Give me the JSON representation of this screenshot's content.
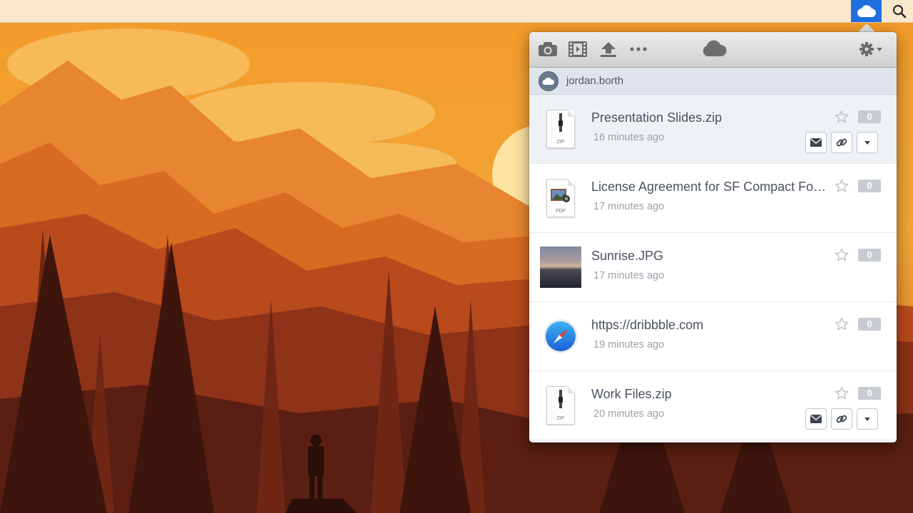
{
  "menubar": {
    "cloud_icon": "cloud-icon",
    "search_icon": "search-icon",
    "accent_color": "#1f6fe0"
  },
  "toolbar": {
    "icons": [
      "camera-icon",
      "film-icon",
      "upload-icon",
      "more-icon",
      "cloud-icon",
      "gear-icon"
    ]
  },
  "account": {
    "username": "jordan.borth"
  },
  "files": [
    {
      "name": "Presentation Slides.zip",
      "time": "16 minutes ago",
      "type": "zip",
      "ext_label": "ZIP",
      "count": "0",
      "selected": true
    },
    {
      "name": "License Agreement for SF Compact Fonts.pdf",
      "time": "17 minutes ago",
      "type": "pdf",
      "ext_label": "PDF",
      "count": "0",
      "selected": false
    },
    {
      "name": "Sunrise.JPG",
      "time": "17 minutes ago",
      "type": "image",
      "count": "0",
      "selected": false
    },
    {
      "name": "https://dribbble.com",
      "time": "19 minutes ago",
      "type": "link",
      "count": "0",
      "selected": false
    },
    {
      "name": "Work Files.zip",
      "time": "20 minutes ago",
      "type": "zip",
      "ext_label": "ZIP",
      "count": "0",
      "selected": false
    }
  ]
}
